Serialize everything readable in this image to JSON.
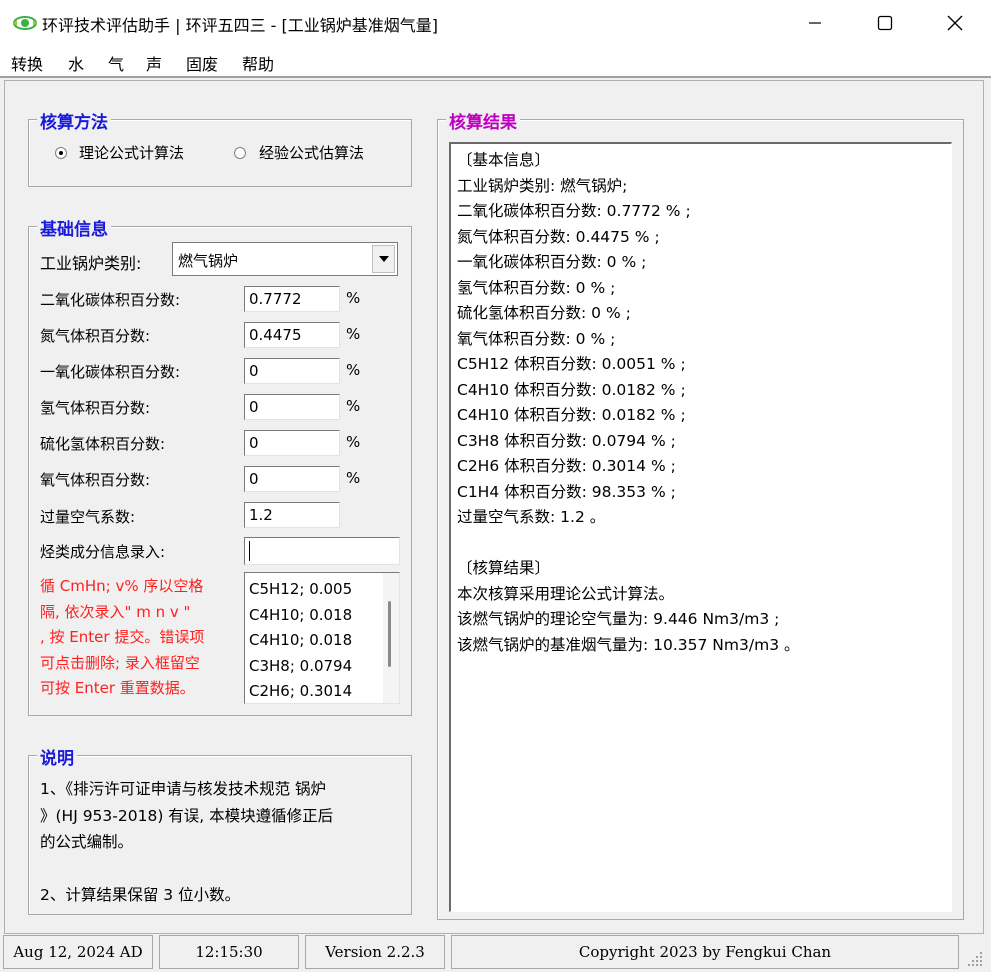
{
  "window": {
    "title": "环评技术评估助手 | 环评五四三 - [工业锅炉基准烟气量]"
  },
  "menu": [
    "转换",
    "水",
    "气",
    "声",
    "固废",
    "帮助"
  ],
  "method": {
    "title": "核算方法",
    "options": [
      {
        "label": "理论公式计算法",
        "selected": true
      },
      {
        "label": "经验公式估算法",
        "selected": false
      }
    ]
  },
  "basic": {
    "title": "基础信息",
    "boiler_type_label": "工业锅炉类别:",
    "boiler_type_value": "燃气锅炉",
    "fields": [
      {
        "label": "二氧化碳体积百分数:",
        "value": "0.7772",
        "unit": "%"
      },
      {
        "label": "氮气体积百分数:",
        "value": "0.4475",
        "unit": "%"
      },
      {
        "label": "一氧化碳体积百分数:",
        "value": "0",
        "unit": "%"
      },
      {
        "label": "氢气体积百分数:",
        "value": "0",
        "unit": "%"
      },
      {
        "label": "硫化氢体积百分数:",
        "value": "0",
        "unit": "%"
      },
      {
        "label": "氧气体积百分数:",
        "value": "0",
        "unit": "%"
      },
      {
        "label": "过量空气系数:",
        "value": "1.2",
        "unit": ""
      }
    ],
    "hydrocarbon_label": "烃类成分信息录入:",
    "hydrocarbon_input": "",
    "hint_lines": [
      "循 CmHn; v% 序以空格",
      "隔, 依次录入\" m n v \"",
      ", 按 Enter 提交。错误项",
      "可点击删除; 录入框留空",
      "可按 Enter 重置数据。"
    ],
    "hydrocarbon_list": [
      "C5H12; 0.005",
      "C4H10; 0.018",
      "C4H10; 0.018",
      "C3H8; 0.0794",
      "C2H6; 0.3014"
    ]
  },
  "notes": {
    "title": "说明",
    "lines": [
      "1、《排污许可证申请与核发技术规范 锅炉",
      "》(HJ 953-2018) 有误, 本模块遵循修正后",
      "的公式编制。",
      "",
      "2、计算结果保留 3 位小数。"
    ]
  },
  "result": {
    "title": "核算结果",
    "lines": [
      "〔基本信息〕",
      "工业锅炉类别: 燃气锅炉;",
      "二氧化碳体积百分数: 0.7772 % ;",
      "氮气体积百分数: 0.4475 % ;",
      "一氧化碳体积百分数: 0 % ;",
      "氢气体积百分数: 0 % ;",
      "硫化氢体积百分数: 0 % ;",
      "氧气体积百分数: 0 % ;",
      "C5H12 体积百分数: 0.0051 % ;",
      "C4H10 体积百分数: 0.0182 % ;",
      "C4H10 体积百分数: 0.0182 % ;",
      "C3H8 体积百分数: 0.0794 % ;",
      "C2H6 体积百分数: 0.3014 % ;",
      "C1H4 体积百分数: 98.353 % ;",
      "过量空气系数: 1.2 。",
      "",
      "〔核算结果〕",
      "本次核算采用理论公式计算法。",
      "该燃气锅炉的理论空气量为: 9.446 Nm3/m3 ;",
      "该燃气锅炉的基准烟气量为: 10.357 Nm3/m3 。"
    ]
  },
  "status": {
    "date": "Aug 12, 2024 AD",
    "time": "12:15:30",
    "version": "Version 2.2.3",
    "copyright": "Copyright 2023 by Fengkui Chan"
  },
  "colors": {
    "method_title": "#1a1adb",
    "basic_title": "#1a1adb",
    "notes_title": "#1a1adb",
    "result_title": "#c000c0",
    "hint_text": "#ff2020",
    "icon_green": "#3cb043"
  }
}
